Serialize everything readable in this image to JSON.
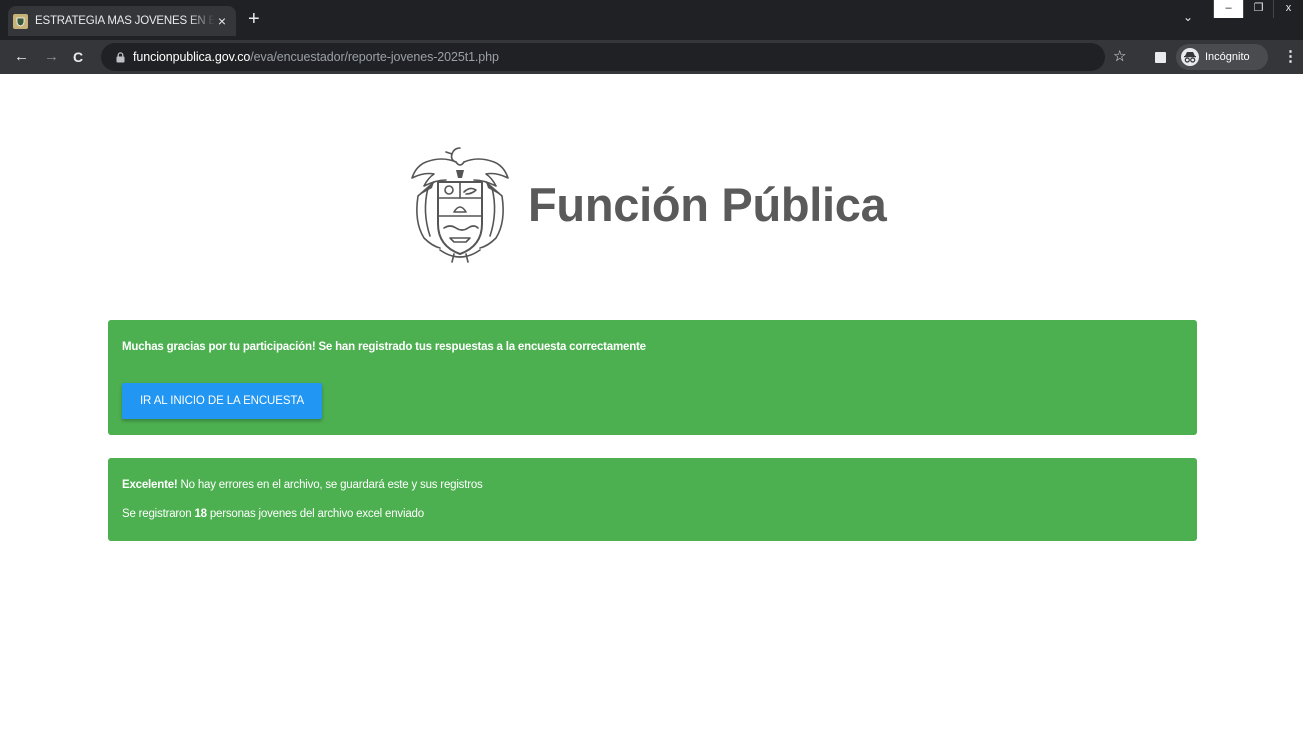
{
  "browser": {
    "tab_title": "ESTRATEGIA MÁS JÓVENES EN EL",
    "tab_close": "×",
    "new_tab": "+",
    "tab_search": "⌄",
    "window_min": "–",
    "window_restore": "❐",
    "window_close": "x",
    "back": "←",
    "forward": "→",
    "reload": "C",
    "url_host": "funcionpublica.gov.co",
    "url_path": "/eva/encuestador/reporte-jovenes-2025t1.php",
    "bookmark": "☆",
    "incognito_label": "Incógnito",
    "menu": "⋮"
  },
  "logo": {
    "text": "Función Pública",
    "emblem": "coat-of-arms-colombia"
  },
  "alert_success": {
    "message": "Muchas gracias por tu participación! Se han registrado tus respuestas a la encuesta correctamente",
    "button_label": "IR AL INICIO DE LA ENCUESTA"
  },
  "alert_file": {
    "line1_bold": "Excelente!",
    "line1_rest": " No hay errores en el archivo, se guardará este y sus registros",
    "line2_pre": "Se registraron ",
    "line2_count": "18",
    "line2_post": " personas jovenes del archivo excel enviado"
  },
  "colors": {
    "alert_green": "#4caf50",
    "button_blue": "#2196f3",
    "logo_gray": "#5a5a5a",
    "chrome_dark": "#202124",
    "chrome_toolbar": "#35363a"
  }
}
